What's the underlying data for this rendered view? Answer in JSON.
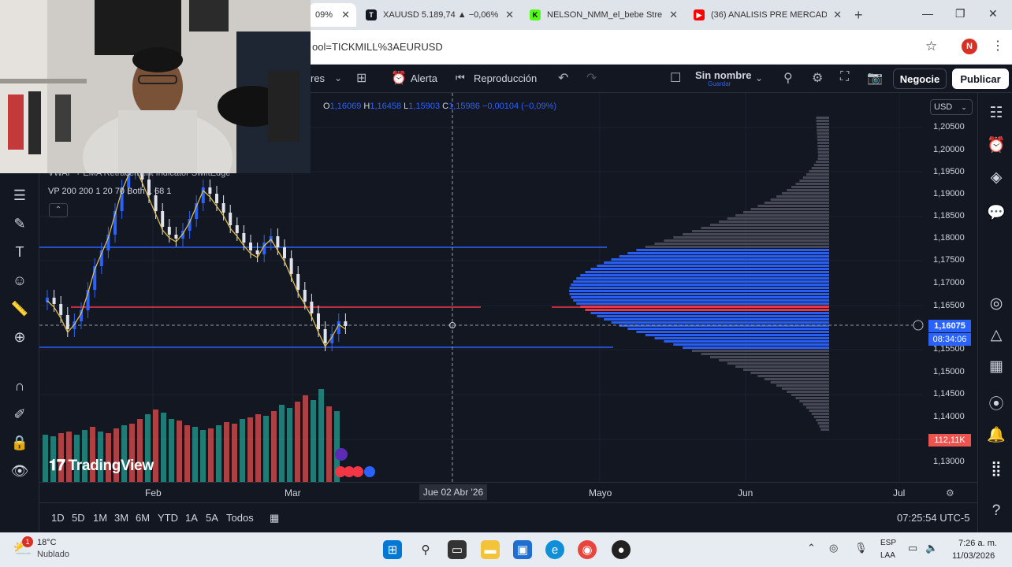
{
  "browser": {
    "tabs": [
      {
        "title": "09%",
        "favicon_color": "#ffffff"
      },
      {
        "title": "XAUUSD 5.189,74 ▲ −0,06%",
        "favicon_color": "#131722"
      },
      {
        "title": "NELSON_NMM_el_bebe Stre",
        "favicon_color": "#53fc18"
      },
      {
        "title": "(36) ANALISIS PRE MERCAD",
        "favicon_color": "#ff0000"
      }
    ],
    "url": "ool=TICKMILL%3AEURUSD",
    "profile_initial": "N"
  },
  "toolbar": {
    "interval_suffix": "res",
    "alert_label": "Alerta",
    "replay_label": "Reproducción",
    "layout_name": "Sin nombre",
    "save_sublabel": "Guardar",
    "trade_label": "Negocie",
    "publish_label": "Publicar"
  },
  "legend": {
    "open_key": "O",
    "open": "1,16069",
    "high_key": "H",
    "high": "1,16458",
    "low_key": "L",
    "low": "1,15903",
    "close_key": "C",
    "close": "1,15986",
    "change": "−0,00104 (−0,09%)",
    "indicator1": "VWAP + EMA Retracement Indicator SwiftEdge",
    "indicator2": "VP 200 200 1 20 70 Both 1 68 1",
    "watermark": "TradingView"
  },
  "price_axis": {
    "currency": "USD",
    "labels": [
      "1,20500",
      "1,20000",
      "1,19500",
      "1,19000",
      "1,18500",
      "1,18000",
      "1,17500",
      "1,17000",
      "1,16500",
      "1,16075",
      "1,15500",
      "1,15000",
      "1,14500",
      "1,14000",
      "1,13000"
    ],
    "current_price": "1,16075",
    "countdown": "08:34:06",
    "volume_label": "112,11K"
  },
  "time_axis": {
    "labels": [
      "Feb",
      "Mar",
      "Mayo",
      "Jun",
      "Jul"
    ],
    "crosshair_date": "Jue 02 Abr '26"
  },
  "ranges": [
    "1D",
    "5D",
    "1M",
    "3M",
    "6M",
    "YTD",
    "1A",
    "5A",
    "Todos"
  ],
  "clock": "07:25:54 UTC-5",
  "taskbar": {
    "notification_count": "1",
    "temperature": "18°C",
    "weather": "Nublado",
    "lang_line1": "ESP",
    "lang_line2": "LAA",
    "time": "7:26 a. m.",
    "date": "11/03/2026"
  },
  "colors": {
    "accent_blue": "#2962ff",
    "bear_red": "#ef5350",
    "bull_green": "#26a69a",
    "background": "#131722"
  }
}
